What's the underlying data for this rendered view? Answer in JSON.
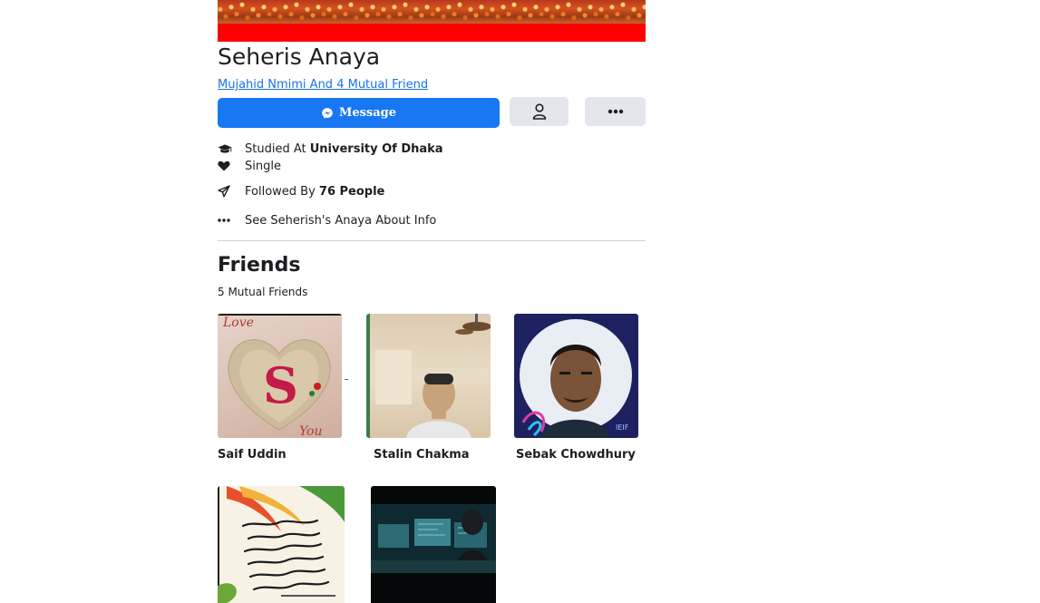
{
  "profile": {
    "name": "Seheris Anaya",
    "mutual_link": "Mujahid Nmimi And 4 Mutual Friend"
  },
  "actions": {
    "message_label": "Message"
  },
  "info": {
    "studied_prefix": "Studied At ",
    "studied_place": "University Of Dhaka",
    "relationship": "Single",
    "followed_prefix": "Followed By ",
    "followed_count": "76 People",
    "about": "See Seherish's Anaya About Info"
  },
  "friends": {
    "title": "Friends",
    "subtitle": "5 Mutual Friends",
    "items": [
      {
        "name": "Saif Uddin"
      },
      {
        "name": "Stalin Chakma"
      },
      {
        "name": "Sebak Chowdhury"
      },
      {
        "name": ""
      },
      {
        "name": ""
      }
    ]
  },
  "icons": {
    "graduation": "graduation-cap-icon",
    "heart": "heart-icon",
    "follow": "paper-plane-icon",
    "about": "more-dots-icon",
    "messenger": "messenger-icon",
    "friend": "person-icon",
    "more": "more-dots-icon"
  },
  "colors": {
    "accent": "#1877f2",
    "link": "#1a73e8",
    "button_gray": "#e4e6eb",
    "cover_strip": "#ff0000"
  }
}
